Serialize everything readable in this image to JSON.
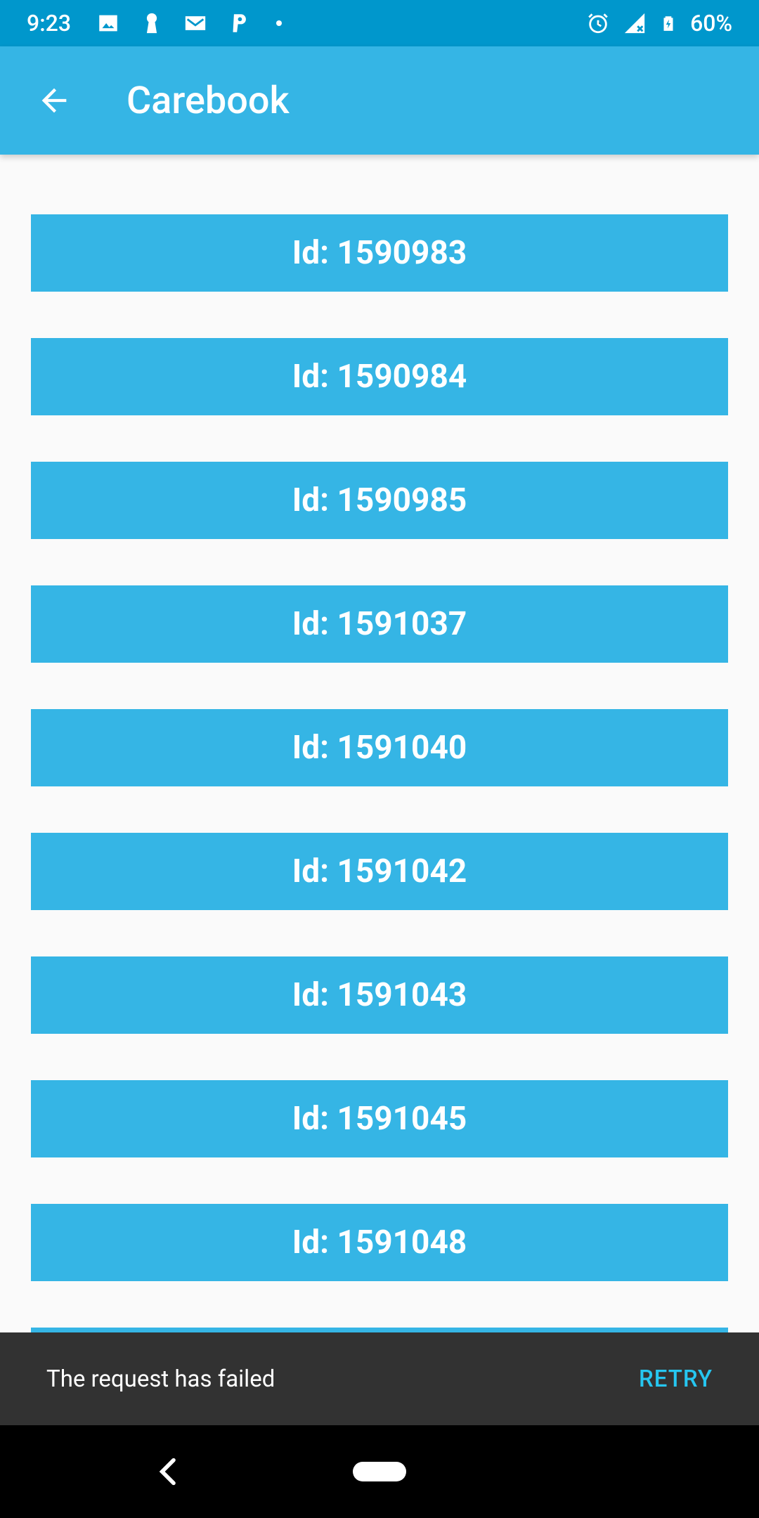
{
  "status_bar": {
    "time": "9:23",
    "battery": "60%",
    "left_icons": [
      "image-icon",
      "keyhole-icon",
      "gmail-icon",
      "paypal-icon",
      "dot-icon"
    ],
    "right_icons": [
      "alarm-icon",
      "signal-icon",
      "battery-charging-icon"
    ]
  },
  "app_bar": {
    "title": "Carebook",
    "back_icon": "arrow-back-icon"
  },
  "list": {
    "items": [
      {
        "label": ""
      },
      {
        "label": "Id: 1590983"
      },
      {
        "label": "Id: 1590984"
      },
      {
        "label": "Id: 1590985"
      },
      {
        "label": "Id: 1591037"
      },
      {
        "label": "Id: 1591040"
      },
      {
        "label": "Id: 1591042"
      },
      {
        "label": "Id: 1591043"
      },
      {
        "label": "Id: 1591045"
      },
      {
        "label": "Id: 1591048"
      },
      {
        "label": ""
      }
    ]
  },
  "snackbar": {
    "message": "The request has failed",
    "action": "RETRY"
  },
  "nav_bar": {
    "back_icon": "nav-back-icon",
    "home_icon": "nav-home-pill"
  },
  "colors": {
    "status_bar": "#0097cc",
    "app_bar": "#35b5e5",
    "item": "#35b5e5",
    "snackbar": "#323232",
    "snackbar_action": "#26c6f0"
  }
}
